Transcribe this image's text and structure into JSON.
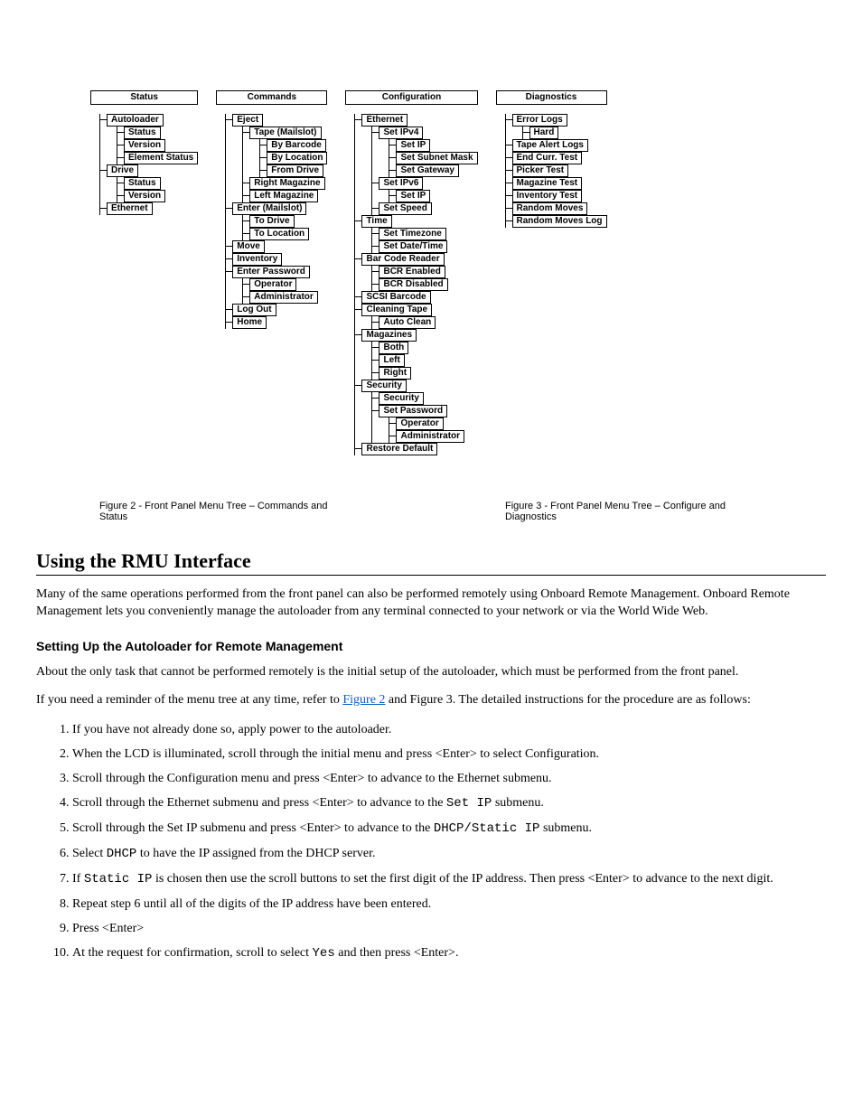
{
  "trees": {
    "status": {
      "header": "Status",
      "items": [
        {
          "label": "Autoloader",
          "children": [
            {
              "label": "Status"
            },
            {
              "label": "Version"
            },
            {
              "label": "Element Status"
            }
          ]
        },
        {
          "label": "Drive",
          "children": [
            {
              "label": "Status"
            },
            {
              "label": "Version"
            }
          ]
        },
        {
          "label": "Ethernet"
        }
      ]
    },
    "commands": {
      "header": "Commands",
      "items": [
        {
          "label": "Eject",
          "children": [
            {
              "label": "Tape (Mailslot)",
              "children": [
                {
                  "label": "By Barcode"
                },
                {
                  "label": "By Location"
                },
                {
                  "label": "From Drive"
                }
              ]
            },
            {
              "label": "Right Magazine"
            },
            {
              "label": "Left Magazine"
            }
          ]
        },
        {
          "label": "Enter (Mailslot)",
          "children": [
            {
              "label": "To Drive"
            },
            {
              "label": "To Location"
            }
          ]
        },
        {
          "label": "Move"
        },
        {
          "label": "Inventory"
        },
        {
          "label": "Enter Password",
          "children": [
            {
              "label": "Operator"
            },
            {
              "label": "Administrator"
            }
          ]
        },
        {
          "label": "Log Out"
        },
        {
          "label": "Home"
        }
      ]
    },
    "configuration": {
      "header": "Configuration",
      "items": [
        {
          "label": "Ethernet",
          "children": [
            {
              "label": "Set IPv4",
              "children": [
                {
                  "label": "Set IP"
                },
                {
                  "label": "Set Subnet Mask"
                },
                {
                  "label": "Set Gateway"
                }
              ]
            },
            {
              "label": "Set IPv6",
              "children": [
                {
                  "label": "Set IP"
                }
              ]
            },
            {
              "label": "Set Speed"
            }
          ]
        },
        {
          "label": "Time",
          "children": [
            {
              "label": "Set Timezone"
            },
            {
              "label": "Set Date/Time"
            }
          ]
        },
        {
          "label": "Bar Code Reader",
          "children": [
            {
              "label": "BCR Enabled"
            },
            {
              "label": "BCR Disabled"
            }
          ]
        },
        {
          "label": "SCSI Barcode"
        },
        {
          "label": "Cleaning Tape",
          "children": [
            {
              "label": "Auto Clean"
            }
          ]
        },
        {
          "label": "Magazines",
          "children": [
            {
              "label": "Both"
            },
            {
              "label": "Left"
            },
            {
              "label": "Right"
            }
          ]
        },
        {
          "label": "Security",
          "children": [
            {
              "label": "Security"
            },
            {
              "label": "Set Password",
              "children": [
                {
                  "label": "Operator"
                },
                {
                  "label": "Administrator"
                }
              ]
            }
          ]
        },
        {
          "label": "Restore Default"
        }
      ]
    },
    "diagnostics": {
      "header": "Diagnostics",
      "items": [
        {
          "label": "Error Logs",
          "children": [
            {
              "label": "Hard"
            }
          ]
        },
        {
          "label": "Tape Alert Logs"
        },
        {
          "label": "End Curr. Test"
        },
        {
          "label": "Picker Test"
        },
        {
          "label": "Magazine Test"
        },
        {
          "label": "Inventory Test"
        },
        {
          "label": "Random Moves"
        },
        {
          "label": "Random Moves Log"
        }
      ]
    }
  },
  "captions": {
    "fig2": "Figure 2 - Front Panel Menu Tree – Commands and Status",
    "fig3": "Figure 3 - Front Panel Menu Tree – Configure and Diagnostics"
  },
  "heading3": "Using the RMU Interface",
  "para1": "Many of the same operations performed from the front panel can also be performed remotely using Onboard Remote Management. Onboard Remote Management lets you conveniently manage the autoloader from any terminal connected to your network or via the World Wide Web.",
  "heading4": "Setting Up the Autoloader for Remote Management",
  "para2": "About the only task that cannot be performed remotely is the initial setup of the autoloader, which must be performed from the front panel.",
  "para3_a": "If you need a reminder of the menu tree at any time, refer to ",
  "para3_link": "Figure 2",
  "para3_b": " and Figure 3. The detailed instructions for the procedure are as follows:",
  "ol": {
    "i1": "If you have not already done so, apply power to the autoloader.",
    "i2": "When the LCD is illuminated, scroll through the initial menu and press <Enter> to select Configuration.",
    "i3": "Scroll through the Configuration menu and press <Enter> to advance to the Ethernet submenu.",
    "i4_a": "Scroll through the Ethernet submenu and press <Enter> to advance to the ",
    "i4_b": "Set IP",
    "i4_c": " submenu.",
    "i5_a": "Scroll through the Set IP submenu and press <Enter> to advance to the ",
    "i5_b": "DHCP/Static IP",
    "i5_c": " submenu.",
    "i6_a": "Select ",
    "i6_b": "DHCP",
    "i6_c": " to have the IP assigned from the DHCP server.",
    "i7_a": "If ",
    "i7_b": "Static IP",
    "i7_c": " is chosen then use the scroll buttons to set the first digit of the IP address. Then press <Enter> to advance to the next digit.",
    "i8": "Repeat step 6 until all of the digits of the IP address have been entered.",
    "i9": "Press <Enter>",
    "i10_a": "At the request for confirmation, scroll to select ",
    "i10_b": "Yes",
    "i10_c": " and then press <Enter>."
  }
}
